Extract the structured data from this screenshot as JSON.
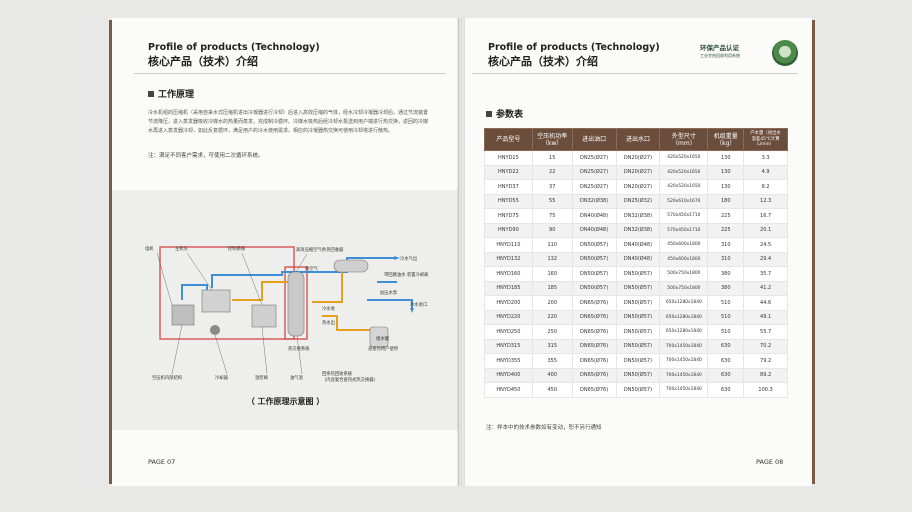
{
  "left_page": {
    "title_en": "Profile of products (Technology)",
    "title_cn": "核心产品（技术）介绍",
    "section_title": "工作原理",
    "paragraph": "冷水机组的压缩机（采用自来水式压缩机进出冷凝器进行冷却）后进入高效压缩的气体，经水冷却冷凝器冷却后，通过节流装置节流降压，进入蒸发器吸收冷媒水的热量而蒸发，完成制冷循环。冷媒水吸热后经冷却水泵送到用户端进行热交换，返回的冷媒水再进入蒸发器冷却，如此反复循环，满足用户的冷水使用需求。相应的冷凝器热交换可使用冷却塔进行散热。",
    "note": "注：满足不同客户需求，可使用二次循环系统。",
    "diagram_caption": "（ 工作原理示意图 ）",
    "diagram_labels": {
      "motor": "电机",
      "main_engine": "主机头",
      "control_system": "控制系统",
      "heat_exchanger": "高效压缩空气余热回收器",
      "hot_oil": "热空气",
      "cold_water_out": "冷水气出",
      "oil_separator": "带回路油水\n装置冷却离",
      "reduce_water": "加压水泵",
      "cold_water_in": "冷水进口",
      "hot_water_tank": "回水箱",
      "water_tank": "储水罐",
      "direct_user": "直接热用户使用",
      "compressor_struct": "空压机内部结构",
      "cooler": "冷却器",
      "thermostat": "温控阀",
      "hot_oil_out": "油气温",
      "recovery_system": "回余热回收系统",
      "recovery_note": "（内含复合直热式热交换器）",
      "cold_in_label": "冷水进",
      "hot_out_label": "热水出",
      "unit_label": "热交换系统"
    },
    "page_number": "PAGE 07"
  },
  "right_page": {
    "title_en": "Profile of products (Technology)",
    "title_cn": "核心产品（技术）介绍",
    "badge_title": "环保产品认证",
    "badge_sub": "工业余热回收利用系统",
    "section_title": "参数表",
    "table_headers": [
      "产品型号",
      "空压机功率\n（kw）",
      "进出油口",
      "进出水口",
      "外型尺寸\n（mm）",
      "机组重量\n（kg）",
      "产水量（进出水\n温差45℃计算\nL/min）"
    ],
    "table_rows": [
      [
        "HNYD15",
        "15",
        "DN25(Ø27)",
        "DN20(Ø27)",
        "420x520x1650",
        "130",
        "3.3"
      ],
      [
        "HNYD22",
        "22",
        "DN25(Ø27)",
        "DN20(Ø27)",
        "420x520x1650",
        "130",
        "4.9"
      ],
      [
        "HNYD37",
        "37",
        "DN25(Ø27)",
        "DN20(Ø27)",
        "420x520x1650",
        "130",
        "8.2"
      ],
      [
        "HNYD55",
        "55",
        "DN32(Ø38)",
        "DN25(Ø32)",
        "520x610x1670",
        "180",
        "12.3"
      ],
      [
        "HNYD75",
        "75",
        "DN40(Ø48)",
        "DN32(Ø38)",
        "570x450x1710",
        "225",
        "16.7"
      ],
      [
        "HNYD90",
        "90",
        "DN40(Ø48)",
        "DN32(Ø38)",
        "570x450x1710",
        "225",
        "20.1"
      ],
      [
        "HNYD110",
        "110",
        "DN50(Ø57)",
        "DN40(Ø48)",
        "450x600x1800",
        "310",
        "24.5"
      ],
      [
        "HNYD132",
        "132",
        "DN50(Ø57)",
        "DN40(Ø48)",
        "450x600x1800",
        "310",
        "29.4"
      ],
      [
        "HNYD160",
        "160",
        "DN50(Ø57)",
        "DN50(Ø57)",
        "500x750x1800",
        "380",
        "35.7"
      ],
      [
        "HNYD185",
        "185",
        "DN50(Ø57)",
        "DN50(Ø57)",
        "500x750x1800",
        "380",
        "41.2"
      ],
      [
        "HNYD200",
        "200",
        "DN65(Ø76)",
        "DN50(Ø57)",
        "650x1280x1840",
        "510",
        "44.6"
      ],
      [
        "HNYD220",
        "220",
        "DN65(Ø76)",
        "DN50(Ø57)",
        "650x1280x1840",
        "510",
        "49.1"
      ],
      [
        "HNYD250",
        "250",
        "DN65(Ø76)",
        "DN50(Ø57)",
        "650x1280x1840",
        "510",
        "55.7"
      ],
      [
        "HNYD315",
        "315",
        "DN65(Ø76)",
        "DN50(Ø57)",
        "700x1450x1840",
        "630",
        "70.2"
      ],
      [
        "HNYD355",
        "355",
        "DN65(Ø76)",
        "DN50(Ø57)",
        "700x1450x1840",
        "630",
        "79.2"
      ],
      [
        "HNYD400",
        "400",
        "DN65(Ø76)",
        "DN50(Ø57)",
        "700x1450x1840",
        "630",
        "89.2"
      ],
      [
        "HNYD450",
        "450",
        "DN65(Ø76)",
        "DN50(Ø57)",
        "700x1450x1840",
        "630",
        "100.3"
      ]
    ],
    "table_note": "注：样本中的技术参数如有变动，恕不另行通知",
    "page_number": "PAGE 08"
  },
  "colors": {
    "table_header": "#6b4d3b",
    "pipe_cold": "#3f8fd8",
    "pipe_hot": "#e8a020",
    "frame_red": "#d23a3a",
    "badge_green": "#2e5e34"
  }
}
